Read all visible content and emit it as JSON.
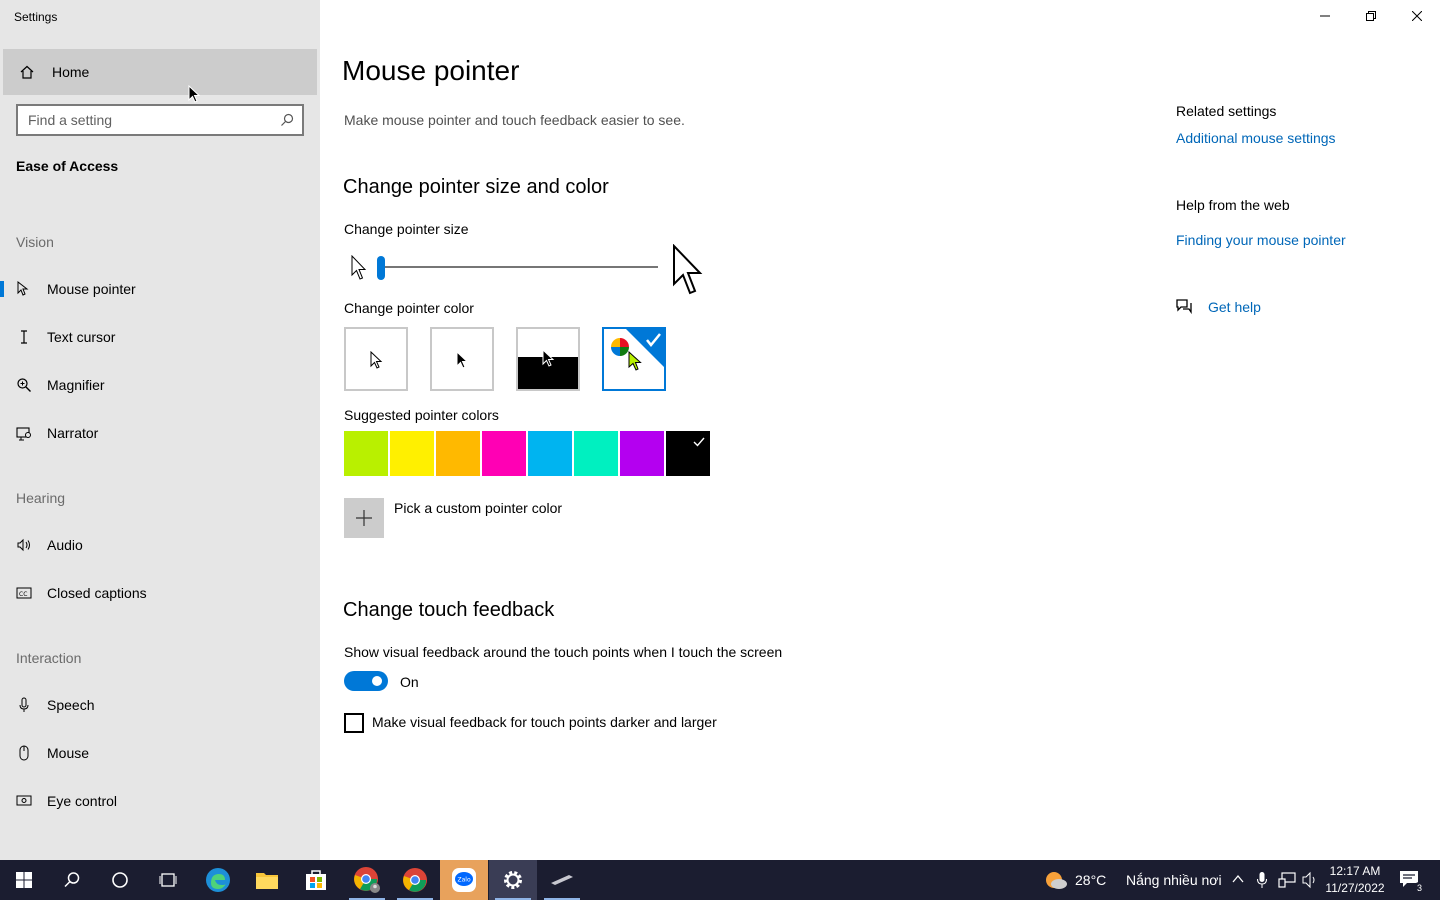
{
  "app": {
    "title": "Settings"
  },
  "sidebar": {
    "home_label": "Home",
    "search_placeholder": "Find a setting",
    "section_title": "Ease of Access",
    "groups": [
      {
        "label": "Vision",
        "items": [
          {
            "label": "Mouse pointer",
            "icon": "mouse-pointer-icon",
            "active": true
          },
          {
            "label": "Text cursor",
            "icon": "text-cursor-icon"
          },
          {
            "label": "Magnifier",
            "icon": "magnifier-icon"
          },
          {
            "label": "Narrator",
            "icon": "narrator-icon"
          }
        ]
      },
      {
        "label": "Hearing",
        "items": [
          {
            "label": "Audio",
            "icon": "audio-icon"
          },
          {
            "label": "Closed captions",
            "icon": "closed-captions-icon"
          }
        ]
      },
      {
        "label": "Interaction",
        "items": [
          {
            "label": "Speech",
            "icon": "microphone-icon"
          },
          {
            "label": "Mouse",
            "icon": "mouse-icon"
          },
          {
            "label": "Eye control",
            "icon": "eye-control-icon"
          }
        ]
      }
    ]
  },
  "main": {
    "title": "Mouse pointer",
    "description": "Make mouse pointer and touch feedback easier to see.",
    "size_color_heading": "Change pointer size and color",
    "pointer_size_label": "Change pointer size",
    "pointer_size_value": 1,
    "pointer_color_label": "Change pointer color",
    "pointer_color_options": [
      "white",
      "black",
      "inverted",
      "custom"
    ],
    "pointer_color_selected": "custom",
    "suggested_label": "Suggested pointer colors",
    "suggested_colors": [
      "#b9f000",
      "#fff000",
      "#ffb900",
      "#ff00b4",
      "#00b4f0",
      "#00f0c0",
      "#b400f0",
      "#000000"
    ],
    "suggested_selected": "#000000",
    "custom_color_label": "Pick a custom pointer color",
    "touch_heading": "Change touch feedback",
    "touch_description": "Show visual feedback around the touch points when I touch the screen",
    "toggle_state": "On",
    "checkbox_label": "Make visual feedback for touch points darker and larger",
    "checkbox_checked": false
  },
  "related": {
    "heading": "Related settings",
    "link": "Additional mouse settings",
    "help_heading": "Help from the web",
    "help_link": "Finding your mouse pointer",
    "get_help": "Get help"
  },
  "taskbar": {
    "weather_temp": "28°C",
    "weather_text": "Nắng nhiều nơi",
    "time": "12:17 AM",
    "date": "11/27/2022",
    "notification_count": "3",
    "accent": "#0078d7"
  }
}
